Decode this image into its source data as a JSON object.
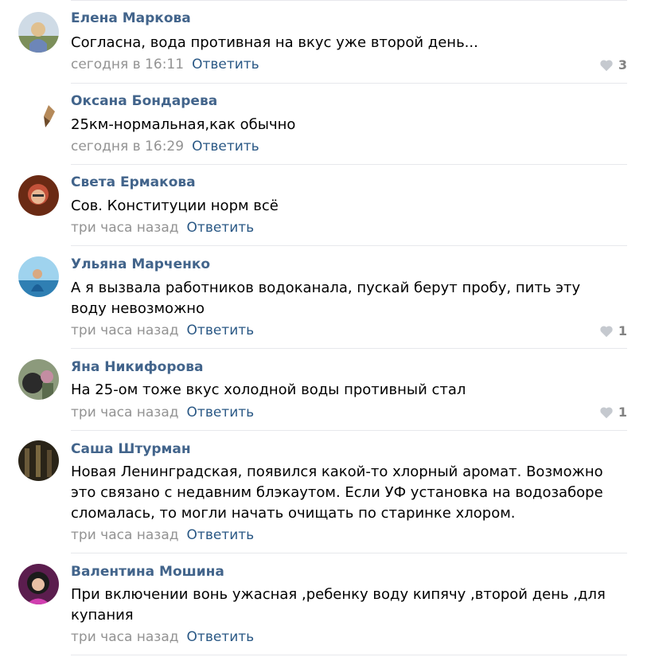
{
  "comments": [
    {
      "author": "Елена Маркова",
      "text": "Согласна, вода противная на вкус уже второй день...",
      "time": "сегодня в 16:11",
      "reply": "Ответить",
      "likes": "3",
      "avatar_color": "#9fb3c8"
    },
    {
      "author": "Оксана Бондарева",
      "text": "25км-нормальная,как обычно",
      "time": "сегодня в 16:29",
      "reply": "Ответить",
      "likes": "",
      "avatar_color": "#c9a57b"
    },
    {
      "author": "Света Ермакова",
      "text": "Сов. Конституции норм всё",
      "time": "три часа назад",
      "reply": "Ответить",
      "likes": "",
      "avatar_color": "#b24a1e"
    },
    {
      "author": "Ульяна Марченко",
      "text": "А я вызвала работников водоканала, пускай берут пробу, пить эту воду невозможно",
      "time": "три часа назад",
      "reply": "Ответить",
      "likes": "1",
      "avatar_color": "#3f86b5"
    },
    {
      "author": "Яна Никифорова",
      "text": "На 25-ом тоже вкус холодной воды противный стал",
      "time": "три часа назад",
      "reply": "Ответить",
      "likes": "1",
      "avatar_color": "#6b6f5a"
    },
    {
      "author": "Саша Штурман",
      "text": "Новая Ленинградская, появился какой-то хлорный аромат. Возможно это связано с недавним блэкаутом. Если УФ установка на водозаборе сломалась, то могли начать очищать по старинке хлором.",
      "time": "три часа назад",
      "reply": "Ответить",
      "likes": "",
      "avatar_color": "#3a3322"
    },
    {
      "author": "Валентина Мошина",
      "text": "При включении вонь ужасная ,ребенку воду кипячу ,второй день ,для купания",
      "time": "три часа назад",
      "reply": "Ответить",
      "likes": "",
      "avatar_color": "#b93aa0"
    }
  ]
}
